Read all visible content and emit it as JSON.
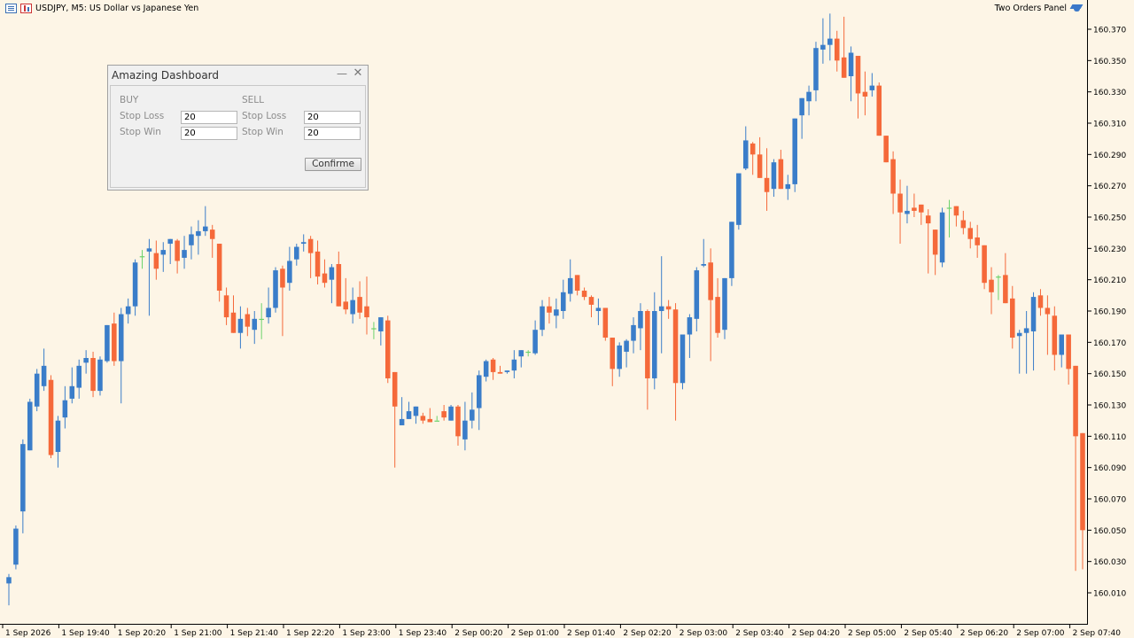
{
  "chart_header": {
    "symbol_line": "USDJPY, M5:  US Dollar vs Japanese Yen",
    "panel_label": "Two Orders Panel",
    "list_icon": "chart-list-icon",
    "type_icon": "candlestick-icon",
    "panel_icon": "graduation-cap-icon"
  },
  "dashboard": {
    "title": "Amazing Dashboard",
    "minimize_icon": "minimize-icon",
    "close_icon": "close-icon",
    "buy_label": "BUY",
    "sell_label": "SELL",
    "buy_stop_loss_label": "Stop Loss",
    "buy_stop_win_label": "Stop Win",
    "sell_stop_loss_label": "Stop Loss",
    "sell_stop_win_label": "Stop Win",
    "buy_stop_loss_value": "20",
    "buy_stop_win_value": "20",
    "sell_stop_loss_value": "20",
    "sell_stop_win_value": "20",
    "confirm_label": "Confirme"
  },
  "colors": {
    "background": "#fdf5e6",
    "bull": "#3a7dc9",
    "bear": "#f5693a",
    "doji": "#6cd36c"
  },
  "chart_data": {
    "type": "candlestick",
    "y_ticks": [
      "160.370",
      "160.350",
      "160.330",
      "160.310",
      "160.290",
      "160.270",
      "160.250",
      "160.230",
      "160.210",
      "160.190",
      "160.170",
      "160.150",
      "160.130",
      "160.110",
      "160.090",
      "160.070",
      "160.050",
      "160.030",
      "160.010"
    ],
    "y_range": [
      160.0,
      160.385
    ],
    "x_ticks": [
      "1 Sep 2026",
      "1 Sep 19:40",
      "1 Sep 20:20",
      "1 Sep 21:00",
      "1 Sep 21:40",
      "1 Sep 22:20",
      "1 Sep 23:00",
      "1 Sep 23:40",
      "2 Sep 00:20",
      "2 Sep 01:00",
      "2 Sep 01:40",
      "2 Sep 02:20",
      "2 Sep 03:00",
      "2 Sep 03:40",
      "2 Sep 04:20",
      "2 Sep 05:00",
      "2 Sep 05:40",
      "2 Sep 06:20",
      "2 Sep 07:00",
      "2 Sep 07:40"
    ],
    "candles": [
      {
        "o": 160.016,
        "h": 160.022,
        "l": 160.002,
        "c": 160.02
      },
      {
        "o": 160.028,
        "h": 160.053,
        "l": 160.025,
        "c": 160.051
      },
      {
        "o": 160.062,
        "h": 160.108,
        "l": 160.048,
        "c": 160.105
      },
      {
        "o": 160.101,
        "h": 160.134,
        "l": 160.101,
        "c": 160.132
      },
      {
        "o": 160.129,
        "h": 160.153,
        "l": 160.126,
        "c": 160.15
      },
      {
        "o": 160.142,
        "h": 160.166,
        "l": 160.139,
        "c": 160.155
      },
      {
        "o": 160.146,
        "h": 160.149,
        "l": 160.096,
        "c": 160.098
      },
      {
        "o": 160.1,
        "h": 160.123,
        "l": 160.09,
        "c": 160.12
      },
      {
        "o": 160.122,
        "h": 160.142,
        "l": 160.115,
        "c": 160.133
      },
      {
        "o": 160.134,
        "h": 160.154,
        "l": 160.131,
        "c": 160.142
      },
      {
        "o": 160.141,
        "h": 160.159,
        "l": 160.134,
        "c": 160.155
      },
      {
        "o": 160.157,
        "h": 160.165,
        "l": 160.15,
        "c": 160.16
      },
      {
        "o": 160.16,
        "h": 160.164,
        "l": 160.135,
        "c": 160.139
      },
      {
        "o": 160.139,
        "h": 160.161,
        "l": 160.136,
        "c": 160.159
      },
      {
        "o": 160.158,
        "h": 160.18,
        "l": 160.157,
        "c": 160.181
      },
      {
        "o": 160.182,
        "h": 160.189,
        "l": 160.155,
        "c": 160.158
      },
      {
        "o": 160.158,
        "h": 160.192,
        "l": 160.131,
        "c": 160.188
      },
      {
        "o": 160.188,
        "h": 160.198,
        "l": 160.182,
        "c": 160.193
      },
      {
        "o": 160.193,
        "h": 160.223,
        "l": 160.187,
        "c": 160.221
      },
      {
        "o": 160.225,
        "h": 160.229,
        "l": 160.217,
        "c": 160.225
      },
      {
        "o": 160.228,
        "h": 160.236,
        "l": 160.187,
        "c": 160.23
      },
      {
        "o": 160.227,
        "h": 160.235,
        "l": 160.21,
        "c": 160.217
      },
      {
        "o": 160.226,
        "h": 160.234,
        "l": 160.215,
        "c": 160.229
      },
      {
        "o": 160.233,
        "h": 160.235,
        "l": 160.22,
        "c": 160.236
      },
      {
        "o": 160.235,
        "h": 160.236,
        "l": 160.214,
        "c": 160.222
      },
      {
        "o": 160.224,
        "h": 160.238,
        "l": 160.217,
        "c": 160.229
      },
      {
        "o": 160.232,
        "h": 160.244,
        "l": 160.223,
        "c": 160.239
      },
      {
        "o": 160.238,
        "h": 160.248,
        "l": 160.226,
        "c": 160.241
      },
      {
        "o": 160.241,
        "h": 160.257,
        "l": 160.238,
        "c": 160.244
      },
      {
        "o": 160.242,
        "h": 160.245,
        "l": 160.224,
        "c": 160.236
      },
      {
        "o": 160.233,
        "h": 160.233,
        "l": 160.196,
        "c": 160.203
      },
      {
        "o": 160.2,
        "h": 160.205,
        "l": 160.181,
        "c": 160.186
      },
      {
        "o": 160.189,
        "h": 160.2,
        "l": 160.176,
        "c": 160.176
      },
      {
        "o": 160.176,
        "h": 160.193,
        "l": 160.166,
        "c": 160.185
      },
      {
        "o": 160.188,
        "h": 160.192,
        "l": 160.174,
        "c": 160.18
      },
      {
        "o": 160.178,
        "h": 160.19,
        "l": 160.169,
        "c": 160.185
      },
      {
        "o": 160.185,
        "h": 160.195,
        "l": 160.172,
        "c": 160.185
      },
      {
        "o": 160.186,
        "h": 160.205,
        "l": 160.182,
        "c": 160.192
      },
      {
        "o": 160.192,
        "h": 160.218,
        "l": 160.189,
        "c": 160.216
      },
      {
        "o": 160.217,
        "h": 160.219,
        "l": 160.174,
        "c": 160.205
      },
      {
        "o": 160.208,
        "h": 160.231,
        "l": 160.203,
        "c": 160.222
      },
      {
        "o": 160.223,
        "h": 160.233,
        "l": 160.219,
        "c": 160.231
      },
      {
        "o": 160.233,
        "h": 160.239,
        "l": 160.228,
        "c": 160.234
      },
      {
        "o": 160.236,
        "h": 160.238,
        "l": 160.211,
        "c": 160.227
      },
      {
        "o": 160.228,
        "h": 160.235,
        "l": 160.207,
        "c": 160.212
      },
      {
        "o": 160.214,
        "h": 160.223,
        "l": 160.205,
        "c": 160.208
      },
      {
        "o": 160.21,
        "h": 160.22,
        "l": 160.195,
        "c": 160.218
      },
      {
        "o": 160.22,
        "h": 160.228,
        "l": 160.21,
        "c": 160.193
      },
      {
        "o": 160.196,
        "h": 160.211,
        "l": 160.188,
        "c": 160.191
      },
      {
        "o": 160.188,
        "h": 160.205,
        "l": 160.182,
        "c": 160.197
      },
      {
        "o": 160.199,
        "h": 160.209,
        "l": 160.185,
        "c": 160.189
      },
      {
        "o": 160.193,
        "h": 160.212,
        "l": 160.175,
        "c": 160.186
      },
      {
        "o": 160.179,
        "h": 160.183,
        "l": 160.172,
        "c": 160.179
      },
      {
        "o": 160.177,
        "h": 160.186,
        "l": 160.168,
        "c": 160.186
      },
      {
        "o": 160.184,
        "h": 160.187,
        "l": 160.144,
        "c": 160.147
      },
      {
        "o": 160.151,
        "h": 160.15,
        "l": 160.09,
        "c": 160.129
      },
      {
        "o": 160.117,
        "h": 160.135,
        "l": 160.117,
        "c": 160.121
      },
      {
        "o": 160.121,
        "h": 160.132,
        "l": 160.121,
        "c": 160.126
      },
      {
        "o": 160.123,
        "h": 160.125,
        "l": 160.118,
        "c": 160.129
      },
      {
        "o": 160.123,
        "h": 160.125,
        "l": 160.118,
        "c": 160.12
      },
      {
        "o": 160.121,
        "h": 160.128,
        "l": 160.119,
        "c": 160.119
      },
      {
        "o": 160.12,
        "h": 160.123,
        "l": 160.12,
        "c": 160.12
      },
      {
        "o": 160.126,
        "h": 160.13,
        "l": 160.12,
        "c": 160.122
      },
      {
        "o": 160.12,
        "h": 160.13,
        "l": 160.121,
        "c": 160.129
      },
      {
        "o": 160.129,
        "h": 160.13,
        "l": 160.104,
        "c": 160.11
      },
      {
        "o": 160.108,
        "h": 160.132,
        "l": 160.101,
        "c": 160.12
      },
      {
        "o": 160.12,
        "h": 160.138,
        "l": 160.115,
        "c": 160.127
      },
      {
        "o": 160.128,
        "h": 160.152,
        "l": 160.114,
        "c": 160.149
      },
      {
        "o": 160.148,
        "h": 160.159,
        "l": 160.145,
        "c": 160.158
      },
      {
        "o": 160.159,
        "h": 160.16,
        "l": 160.146,
        "c": 160.151
      },
      {
        "o": 160.151,
        "h": 160.155,
        "l": 160.15,
        "c": 160.15
      },
      {
        "o": 160.151,
        "h": 160.152,
        "l": 160.15,
        "c": 160.152
      },
      {
        "o": 160.152,
        "h": 160.165,
        "l": 160.147,
        "c": 160.159
      },
      {
        "o": 160.161,
        "h": 160.165,
        "l": 160.154,
        "c": 160.165
      },
      {
        "o": 160.164,
        "h": 160.165,
        "l": 160.161,
        "c": 160.164
      },
      {
        "o": 160.163,
        "h": 160.184,
        "l": 160.162,
        "c": 160.178
      },
      {
        "o": 160.178,
        "h": 160.197,
        "l": 160.174,
        "c": 160.193
      },
      {
        "o": 160.193,
        "h": 160.199,
        "l": 160.182,
        "c": 160.189
      },
      {
        "o": 160.187,
        "h": 160.198,
        "l": 160.179,
        "c": 160.191
      },
      {
        "o": 160.19,
        "h": 160.21,
        "l": 160.185,
        "c": 160.202
      },
      {
        "o": 160.201,
        "h": 160.223,
        "l": 160.196,
        "c": 160.211
      },
      {
        "o": 160.213,
        "h": 160.212,
        "l": 160.2,
        "c": 160.203
      },
      {
        "o": 160.203,
        "h": 160.205,
        "l": 160.197,
        "c": 160.199
      },
      {
        "o": 160.199,
        "h": 160.2,
        "l": 160.186,
        "c": 160.194
      },
      {
        "o": 160.19,
        "h": 160.198,
        "l": 160.181,
        "c": 160.192
      },
      {
        "o": 160.192,
        "h": 160.192,
        "l": 160.171,
        "c": 160.173
      },
      {
        "o": 160.173,
        "h": 160.17,
        "l": 160.142,
        "c": 160.153
      },
      {
        "o": 160.153,
        "h": 160.17,
        "l": 160.148,
        "c": 160.168
      },
      {
        "o": 160.164,
        "h": 160.172,
        "l": 160.154,
        "c": 160.171
      },
      {
        "o": 160.171,
        "h": 160.186,
        "l": 160.163,
        "c": 160.181
      },
      {
        "o": 160.179,
        "h": 160.195,
        "l": 160.165,
        "c": 160.19
      },
      {
        "o": 160.19,
        "h": 160.191,
        "l": 160.127,
        "c": 160.147
      },
      {
        "o": 160.147,
        "h": 160.202,
        "l": 160.14,
        "c": 160.19
      },
      {
        "o": 160.19,
        "h": 160.225,
        "l": 160.163,
        "c": 160.193
      },
      {
        "o": 160.193,
        "h": 160.197,
        "l": 160.185,
        "c": 160.191
      },
      {
        "o": 160.191,
        "h": 160.195,
        "l": 160.12,
        "c": 160.144
      },
      {
        "o": 160.144,
        "h": 160.175,
        "l": 160.14,
        "c": 160.175
      },
      {
        "o": 160.175,
        "h": 160.188,
        "l": 160.16,
        "c": 160.186
      },
      {
        "o": 160.185,
        "h": 160.218,
        "l": 160.177,
        "c": 160.216
      },
      {
        "o": 160.219,
        "h": 160.236,
        "l": 160.218,
        "c": 160.22
      },
      {
        "o": 160.221,
        "h": 160.23,
        "l": 160.158,
        "c": 160.197
      },
      {
        "o": 160.199,
        "h": 160.211,
        "l": 160.173,
        "c": 160.176
      },
      {
        "o": 160.178,
        "h": 160.2,
        "l": 160.172,
        "c": 160.211
      },
      {
        "o": 160.211,
        "h": 160.238,
        "l": 160.206,
        "c": 160.247
      },
      {
        "o": 160.245,
        "h": 160.262,
        "l": 160.242,
        "c": 160.278
      },
      {
        "o": 160.281,
        "h": 160.308,
        "l": 160.28,
        "c": 160.299
      },
      {
        "o": 160.297,
        "h": 160.298,
        "l": 160.277,
        "c": 160.29
      },
      {
        "o": 160.29,
        "h": 160.301,
        "l": 160.281,
        "c": 160.275
      },
      {
        "o": 160.275,
        "h": 160.294,
        "l": 160.254,
        "c": 160.266
      },
      {
        "o": 160.268,
        "h": 160.287,
        "l": 160.263,
        "c": 160.285
      },
      {
        "o": 160.287,
        "h": 160.293,
        "l": 160.273,
        "c": 160.268
      },
      {
        "o": 160.268,
        "h": 160.277,
        "l": 160.261,
        "c": 160.271
      },
      {
        "o": 160.271,
        "h": 160.307,
        "l": 160.266,
        "c": 160.313
      },
      {
        "o": 160.315,
        "h": 160.325,
        "l": 160.3,
        "c": 160.326
      },
      {
        "o": 160.324,
        "h": 160.334,
        "l": 160.315,
        "c": 160.33
      },
      {
        "o": 160.331,
        "h": 160.362,
        "l": 160.324,
        "c": 160.358
      },
      {
        "o": 160.357,
        "h": 160.377,
        "l": 160.348,
        "c": 160.36
      },
      {
        "o": 160.36,
        "h": 160.38,
        "l": 160.35,
        "c": 160.364
      },
      {
        "o": 160.364,
        "h": 160.369,
        "l": 160.343,
        "c": 160.35
      },
      {
        "o": 160.352,
        "h": 160.378,
        "l": 160.339,
        "c": 160.339
      },
      {
        "o": 160.34,
        "h": 160.359,
        "l": 160.324,
        "c": 160.355
      },
      {
        "o": 160.353,
        "h": 160.351,
        "l": 160.313,
        "c": 160.329
      },
      {
        "o": 160.33,
        "h": 160.343,
        "l": 160.315,
        "c": 160.327
      },
      {
        "o": 160.331,
        "h": 160.342,
        "l": 160.327,
        "c": 160.334
      },
      {
        "o": 160.334,
        "h": 160.336,
        "l": 160.31,
        "c": 160.302
      },
      {
        "o": 160.302,
        "h": 160.301,
        "l": 160.285,
        "c": 160.285
      },
      {
        "o": 160.287,
        "h": 160.292,
        "l": 160.252,
        "c": 160.265
      },
      {
        "o": 160.265,
        "h": 160.274,
        "l": 160.233,
        "c": 160.253
      },
      {
        "o": 160.252,
        "h": 160.27,
        "l": 160.246,
        "c": 160.254
      },
      {
        "o": 160.256,
        "h": 160.265,
        "l": 160.25,
        "c": 160.254
      },
      {
        "o": 160.258,
        "h": 160.254,
        "l": 160.245,
        "c": 160.253
      },
      {
        "o": 160.251,
        "h": 160.255,
        "l": 160.214,
        "c": 160.246
      },
      {
        "o": 160.242,
        "h": 160.236,
        "l": 160.213,
        "c": 160.226
      },
      {
        "o": 160.221,
        "h": 160.256,
        "l": 160.218,
        "c": 160.253
      },
      {
        "o": 160.256,
        "h": 160.261,
        "l": 160.237,
        "c": 160.256
      },
      {
        "o": 160.257,
        "h": 160.251,
        "l": 160.244,
        "c": 160.251
      },
      {
        "o": 160.248,
        "h": 160.254,
        "l": 160.239,
        "c": 160.243
      },
      {
        "o": 160.243,
        "h": 160.247,
        "l": 160.23,
        "c": 160.236
      },
      {
        "o": 160.237,
        "h": 160.245,
        "l": 160.224,
        "c": 160.232
      },
      {
        "o": 160.232,
        "h": 160.231,
        "l": 160.204,
        "c": 160.208
      },
      {
        "o": 160.21,
        "h": 160.218,
        "l": 160.188,
        "c": 160.202
      },
      {
        "o": 160.212,
        "h": 160.213,
        "l": 160.197,
        "c": 160.212
      },
      {
        "o": 160.213,
        "h": 160.227,
        "l": 160.204,
        "c": 160.195
      },
      {
        "o": 160.198,
        "h": 160.206,
        "l": 160.166,
        "c": 160.173
      },
      {
        "o": 160.174,
        "h": 160.178,
        "l": 160.15,
        "c": 160.176
      },
      {
        "o": 160.176,
        "h": 160.19,
        "l": 160.15,
        "c": 160.179
      },
      {
        "o": 160.177,
        "h": 160.202,
        "l": 160.152,
        "c": 160.199
      },
      {
        "o": 160.2,
        "h": 160.204,
        "l": 160.187,
        "c": 160.192
      },
      {
        "o": 160.192,
        "h": 160.2,
        "l": 160.162,
        "c": 160.188
      },
      {
        "o": 160.187,
        "h": 160.193,
        "l": 160.152,
        "c": 160.162
      },
      {
        "o": 160.162,
        "h": 160.173,
        "l": 160.154,
        "c": 160.175
      },
      {
        "o": 160.175,
        "h": 160.172,
        "l": 160.143,
        "c": 160.153
      },
      {
        "o": 160.155,
        "h": 160.155,
        "l": 160.024,
        "c": 160.11
      },
      {
        "o": 160.112,
        "h": 160.111,
        "l": 160.025,
        "c": 160.05
      }
    ]
  }
}
